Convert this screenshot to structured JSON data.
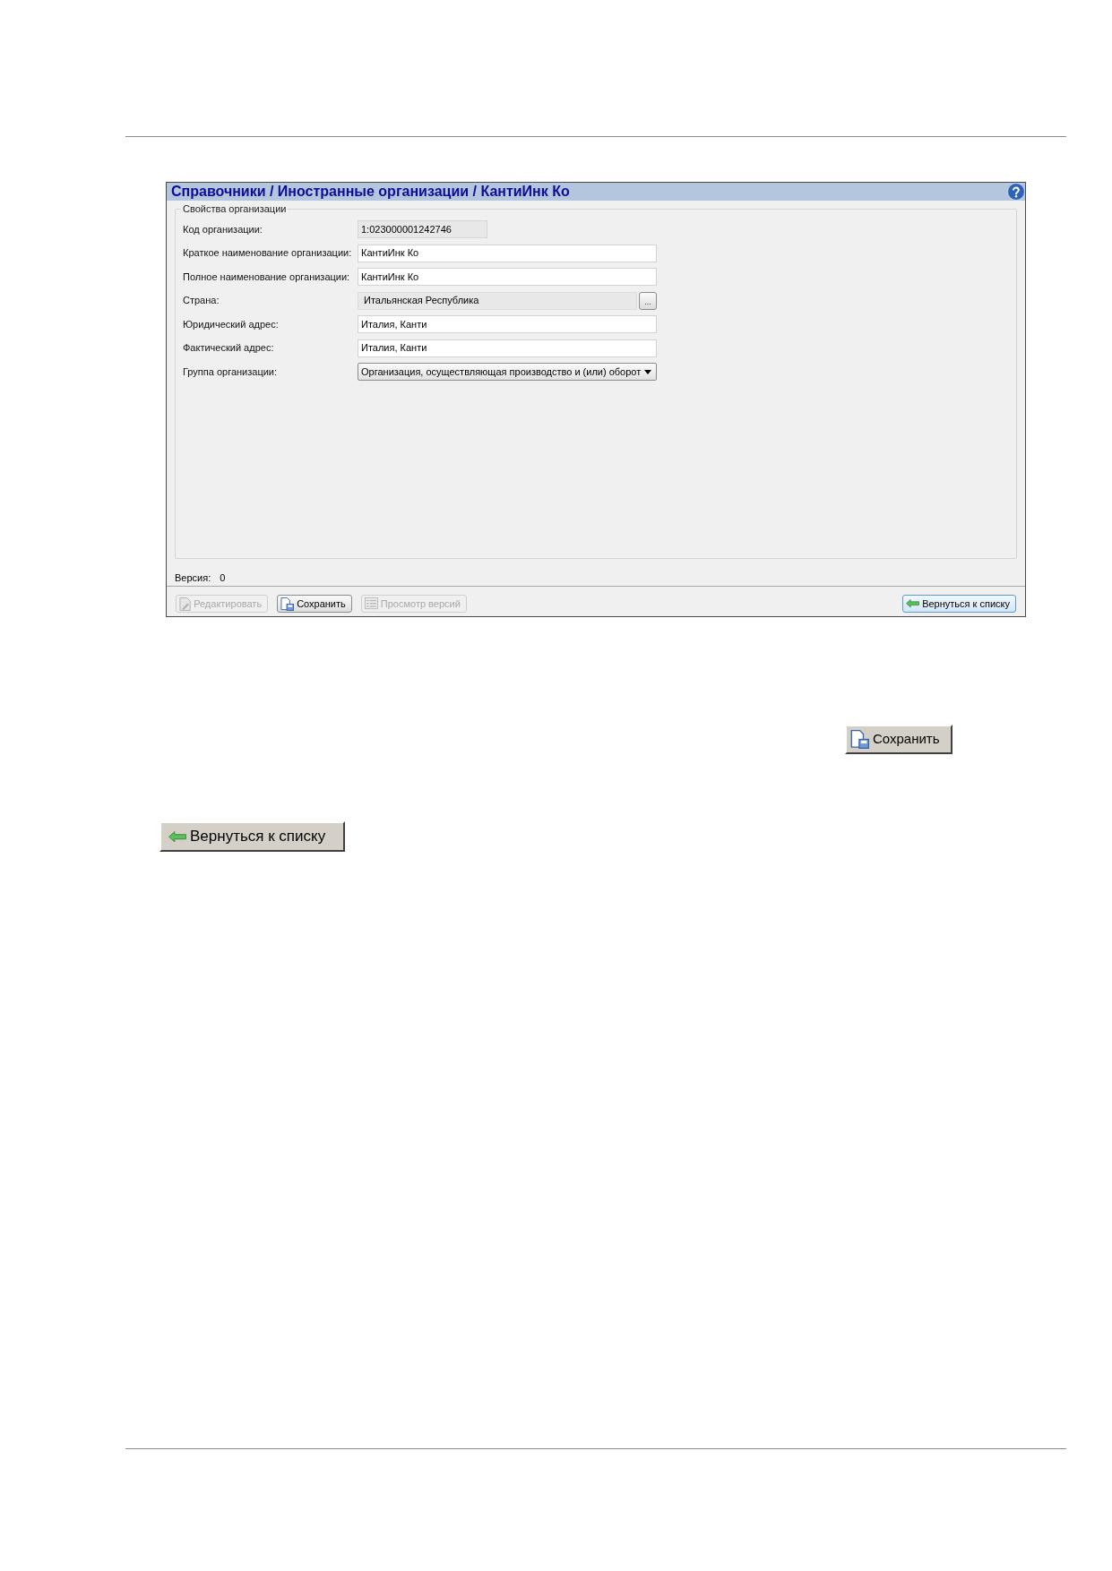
{
  "panel": {
    "title": "Справочники / Иностранные организации / КантиИнк Ко",
    "section": {
      "legend": "Свойства организации",
      "fields": [
        {
          "kind": "readonly",
          "label": "Код организации:",
          "value": "1:023000001242746"
        },
        {
          "kind": "text",
          "label": "Краткое наименование организации:",
          "value": "КантиИнк Ко"
        },
        {
          "kind": "text",
          "label": "Полное наименование организации:",
          "value": "КантиИнк Ко"
        },
        {
          "kind": "picker",
          "label": "Страна:",
          "value": "Итальянская Республика",
          "button": "..."
        },
        {
          "kind": "text",
          "label": "Юридический адрес:",
          "value": "Италия, Канти"
        },
        {
          "kind": "text",
          "label": "Фактический адрес:",
          "value": "Италия, Канти"
        },
        {
          "kind": "select",
          "label": "Группа организации:",
          "value": "Организация, осуществляющая производство и (или) оборот"
        }
      ]
    },
    "version": {
      "label": "Версия:",
      "value": "0"
    },
    "toolbar": [
      {
        "kind": "edit",
        "label": "Редактировать",
        "disabled": true,
        "focused": false
      },
      {
        "kind": "save",
        "label": "Сохранить",
        "disabled": false,
        "focused": false
      },
      {
        "kind": "versions",
        "label": "Просмотр версий",
        "disabled": true,
        "focused": false
      },
      {
        "kind": "back",
        "label": "Вернуться к списку",
        "disabled": false,
        "focused": true
      }
    ]
  },
  "examples": [
    {
      "kind": "save",
      "label": "Сохранить"
    },
    {
      "kind": "back",
      "label": "Вернуться к списку"
    }
  ]
}
